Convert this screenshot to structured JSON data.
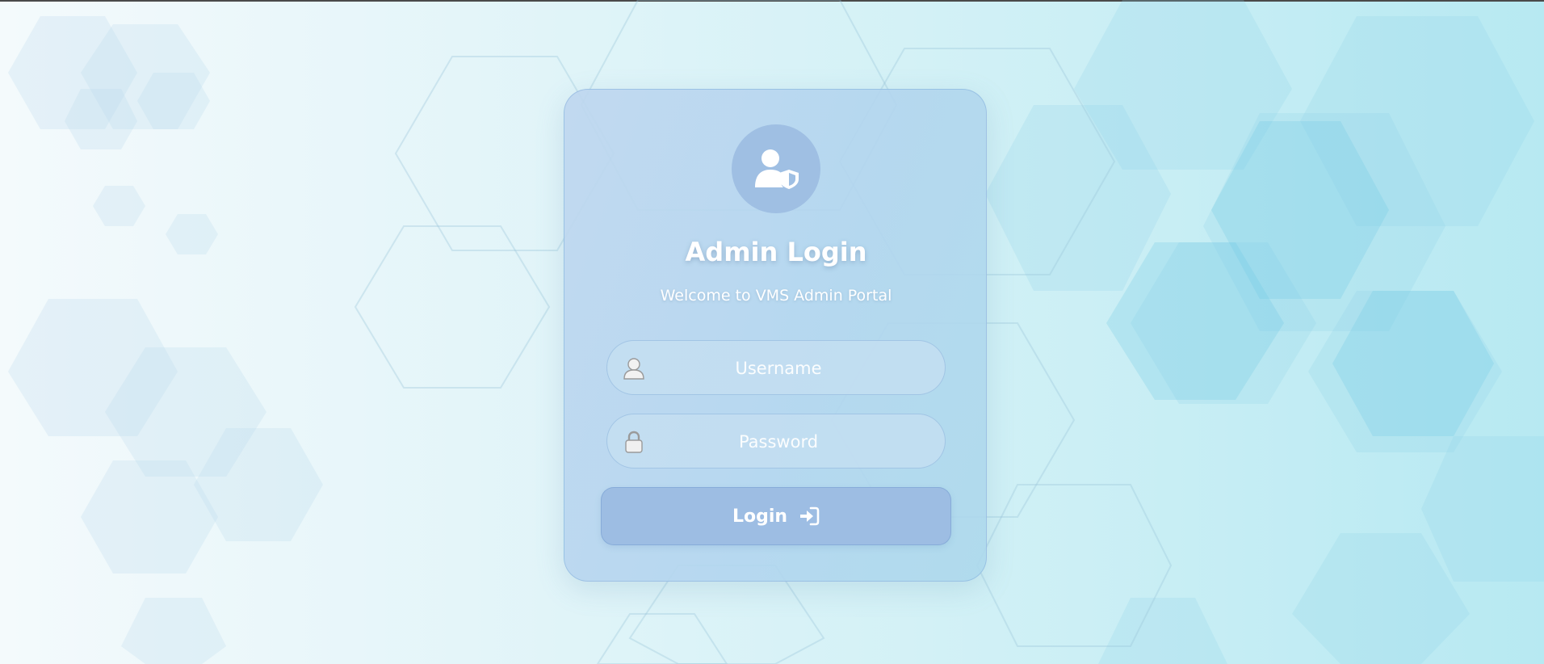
{
  "login": {
    "title": "Admin Login",
    "subtitle": "Welcome to VMS Admin Portal",
    "username": {
      "value": "",
      "placeholder": "Username",
      "icon": "user-icon"
    },
    "password": {
      "value": "",
      "placeholder": "Password",
      "icon": "lock-icon"
    },
    "button": {
      "label": "Login",
      "icon": "sign-in-icon"
    },
    "avatar_icon": "user-shield-icon"
  },
  "colors": {
    "card": "#bcd8ee",
    "avatar_circle": "#9fbfe3",
    "button": "#9dbde3",
    "text": "#ffffff"
  }
}
